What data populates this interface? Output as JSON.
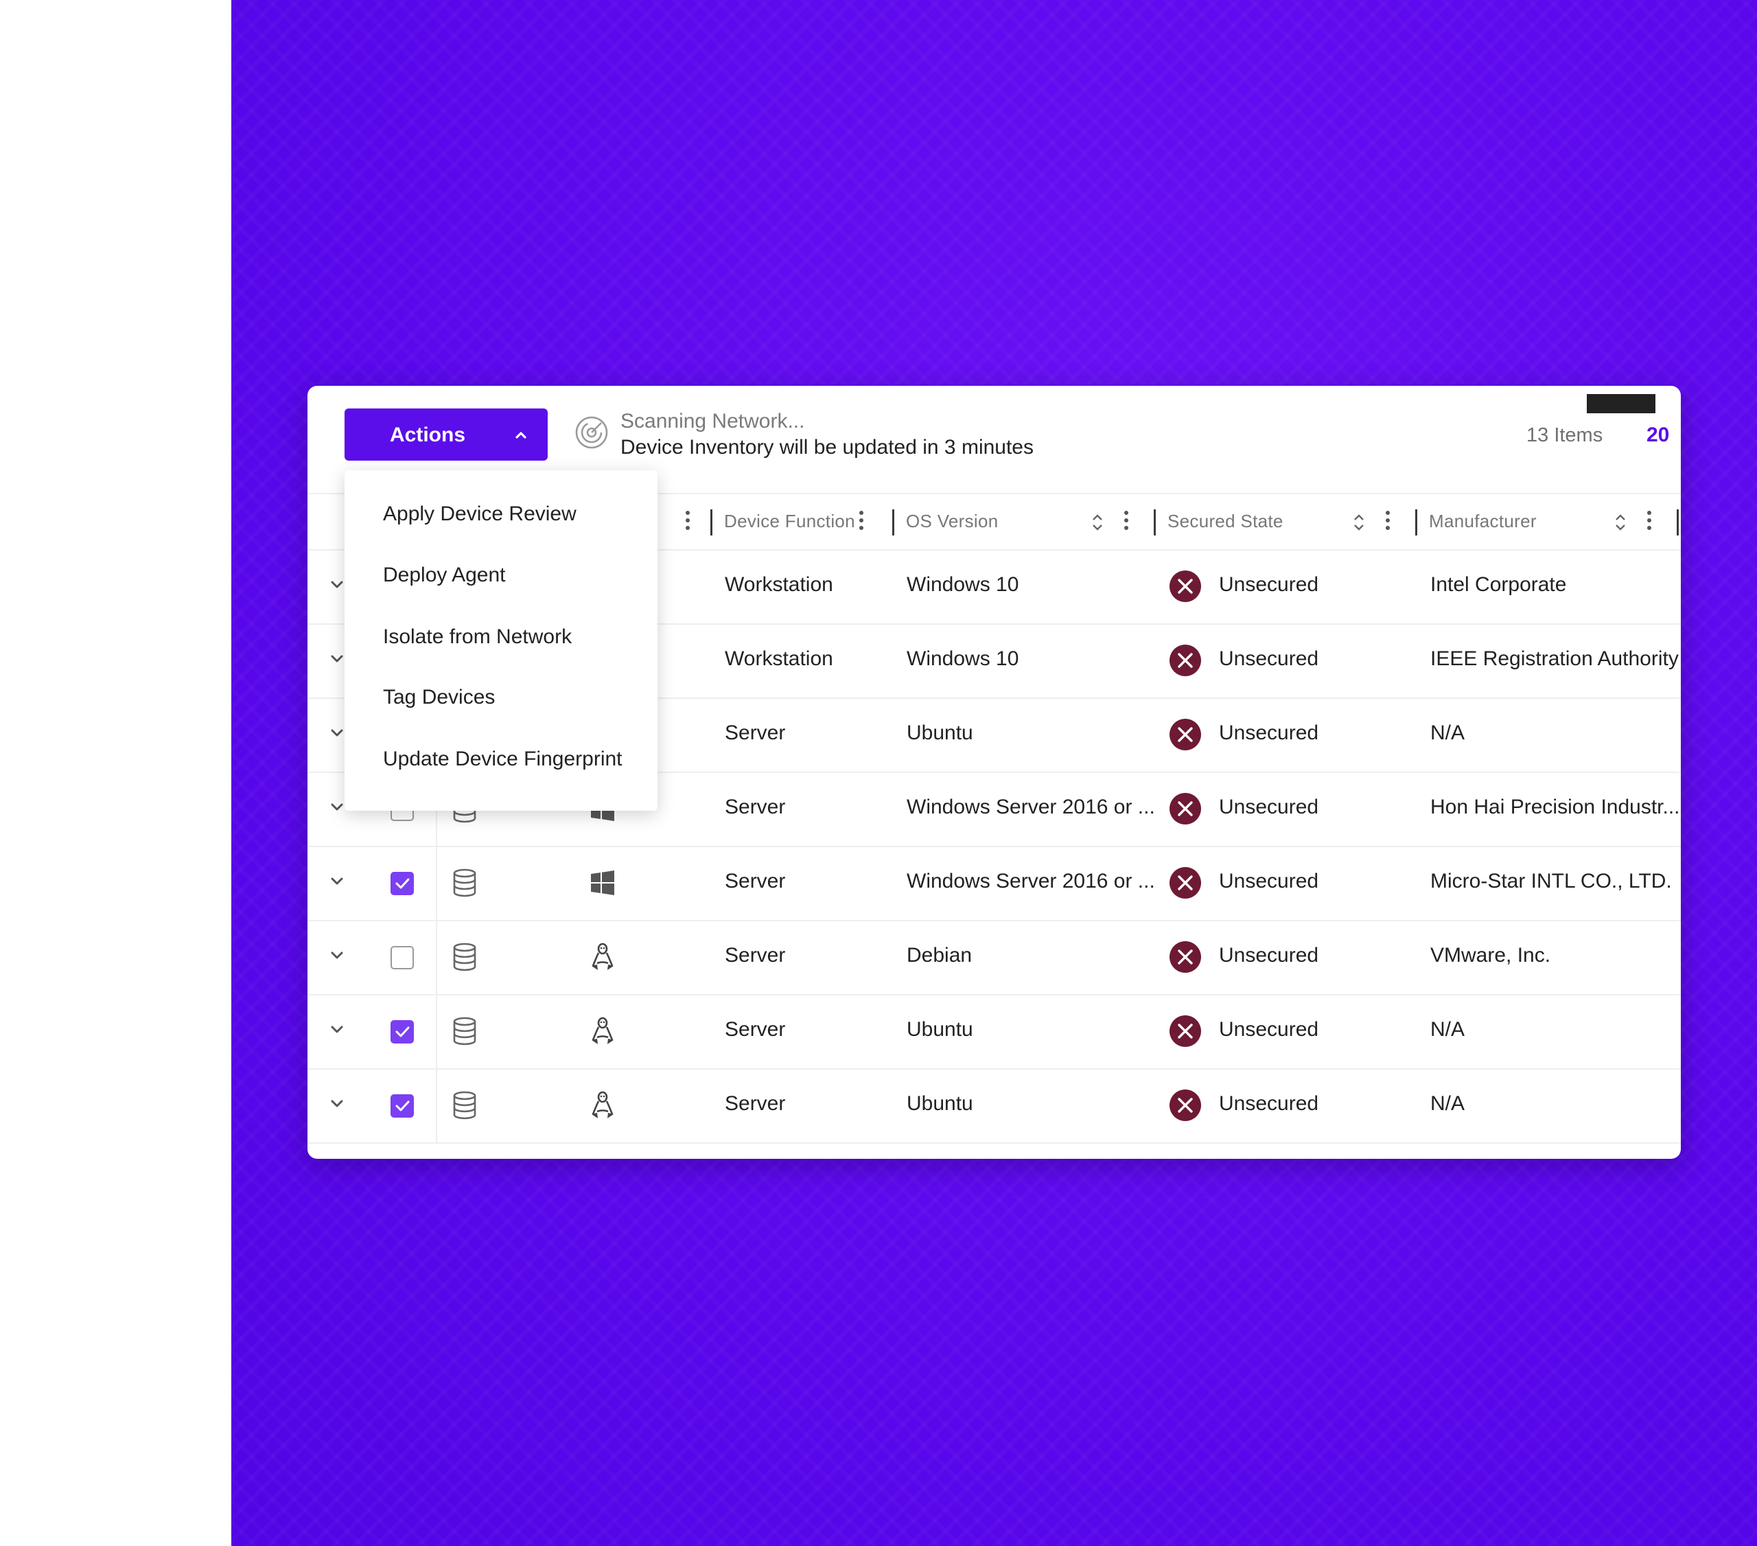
{
  "toolbar": {
    "actions_label": "Actions",
    "scan_title": "Scanning Network...",
    "scan_subtitle": "Device Inventory will be updated in 3 minutes",
    "items_count": "13 Items",
    "page_size": "20"
  },
  "actions_menu": {
    "items": [
      "Apply Device Review",
      "Deploy Agent",
      "Isolate from Network",
      "Tag Devices",
      "Update Device Fingerprint"
    ]
  },
  "table": {
    "columns": {
      "device_function": "Device Function",
      "os_version": "OS Version",
      "secured_state": "Secured State",
      "manufacturer": "Manufacturer"
    },
    "rows": [
      {
        "checked": false,
        "os_icon": "windows-icon",
        "function": "Workstation",
        "os": "Windows 10",
        "state": "Unsecured",
        "manufacturer": "Intel Corporate"
      },
      {
        "checked": false,
        "os_icon": "windows-icon",
        "function": "Workstation",
        "os": "Windows 10",
        "state": "Unsecured",
        "manufacturer": "IEEE Registration Authority"
      },
      {
        "checked": false,
        "os_icon": "linux-icon",
        "function": "Server",
        "os": "Ubuntu",
        "state": "Unsecured",
        "manufacturer": "N/A"
      },
      {
        "checked": false,
        "os_icon": "windows-icon",
        "function": "Server",
        "os": "Windows Server 2016 or ...",
        "state": "Unsecured",
        "manufacturer": "Hon Hai Precision Industr..."
      },
      {
        "checked": true,
        "os_icon": "windows-icon",
        "function": "Server",
        "os": "Windows Server 2016 or ...",
        "state": "Unsecured",
        "manufacturer": "Micro-Star INTL CO., LTD."
      },
      {
        "checked": false,
        "os_icon": "linux-icon",
        "function": "Server",
        "os": "Debian",
        "state": "Unsecured",
        "manufacturer": "VMware, Inc."
      },
      {
        "checked": true,
        "os_icon": "linux-icon",
        "function": "Server",
        "os": "Ubuntu",
        "state": "Unsecured",
        "manufacturer": "N/A"
      },
      {
        "checked": true,
        "os_icon": "linux-icon",
        "function": "Server",
        "os": "Ubuntu",
        "state": "Unsecured",
        "manufacturer": "N/A"
      }
    ]
  },
  "colors": {
    "brand": "#5b0ee9",
    "checkbox_on": "#7b3ff2",
    "unsecured_badge": "#6e1a34",
    "background": "#5b08ec"
  }
}
